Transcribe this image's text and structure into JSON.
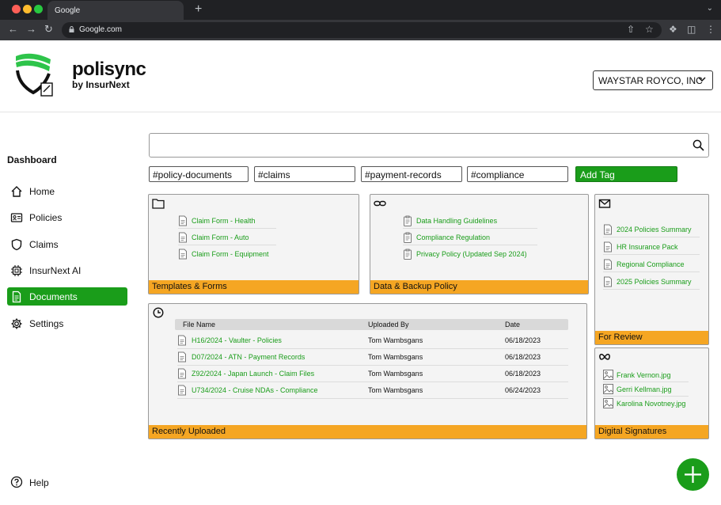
{
  "browser": {
    "tab_title": "Google",
    "url": "Google.com"
  },
  "brand": {
    "name": "polisync",
    "subtitle": "by InsurNext",
    "accent": "#1a9d1a",
    "footer_color": "#f5a623"
  },
  "org_select": {
    "value": "WAYSTAR ROYCO, INC"
  },
  "sidebar": {
    "title": "Dashboard",
    "items": [
      {
        "label": "Home",
        "icon": "home-icon"
      },
      {
        "label": "Policies",
        "icon": "id-card-icon"
      },
      {
        "label": "Claims",
        "icon": "shield-icon"
      },
      {
        "label": "InsurNext AI",
        "icon": "chip-icon"
      },
      {
        "label": "Documents",
        "icon": "document-icon",
        "active": true
      },
      {
        "label": "Settings",
        "icon": "gear-icon"
      }
    ],
    "help_label": "Help"
  },
  "search": {
    "placeholder": ""
  },
  "tags": [
    "#policy-documents",
    "#claims",
    "#payment-records",
    "#compliance"
  ],
  "add_tag_label": "Add Tag",
  "templates": {
    "title": "Templates & Forms",
    "items": [
      "Claim Form - Health",
      "Claim Form - Auto",
      "Claim Form - Equipment"
    ]
  },
  "backup": {
    "title": "Data & Backup Policy",
    "items": [
      "Data Handling Guidelines",
      "Compliance Regulation",
      "Privacy Policy (Updated Sep 2024)"
    ]
  },
  "review": {
    "title": "For Review",
    "items": [
      "2024 Policies Summary",
      "HR Insurance Pack",
      "Regional Compliance",
      "2025 Policies Summary"
    ]
  },
  "recent": {
    "title": "Recently Uploaded",
    "columns": [
      "File Name",
      "Uploaded By",
      "Date"
    ],
    "rows": [
      {
        "name": "H16/2024 - Vaulter - Policies",
        "by": "Tom Wambsgans",
        "date": "06/18/2023"
      },
      {
        "name": "D07/2024 - ATN - Payment Records",
        "by": "Tom Wambsgans",
        "date": "06/18/2023"
      },
      {
        "name": "Z92/2024 - Japan Launch - Claim Files",
        "by": "Tom Wambsgans",
        "date": "06/18/2023"
      },
      {
        "name": "U734/2024 - Cruise NDAs - Compliance",
        "by": "Tom Wambsgans",
        "date": "06/24/2023"
      }
    ]
  },
  "signatures": {
    "title": "Digital Signatures",
    "items": [
      "Frank Vernon.jpg",
      "Gerri Kellman.jpg",
      "Karolina Novotney.jpg"
    ]
  }
}
